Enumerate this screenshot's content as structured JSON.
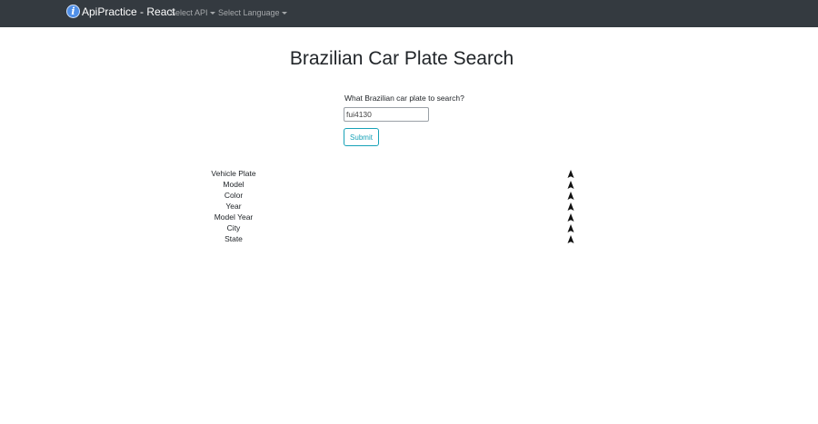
{
  "navbar": {
    "brand_logo_glyph": "i",
    "brand_label": "ApiPractice - React",
    "select_api_label": "Select API",
    "select_language_label": "Select Language"
  },
  "main": {
    "title": "Brazilian Car Plate Search",
    "question": "What Brazilian car plate to search?",
    "plate_input_value": "fui4130",
    "submit_label": "Submit"
  },
  "results": {
    "rows": [
      {
        "label": "Vehicle Plate",
        "icon": "sort-arrow-up-icon"
      },
      {
        "label": "Model",
        "icon": "sort-arrow-up-icon"
      },
      {
        "label": "Color",
        "icon": "sort-arrow-up-icon"
      },
      {
        "label": "Year",
        "icon": "sort-arrow-up-icon"
      },
      {
        "label": "Model Year",
        "icon": "sort-arrow-up-icon"
      },
      {
        "label": "City",
        "icon": "sort-arrow-up-icon"
      },
      {
        "label": "State",
        "icon": "sort-arrow-up-icon"
      }
    ]
  },
  "colors": {
    "navbar_bg": "#343a40",
    "accent_info": "#17a2b8",
    "brand_logo": "#4f8fe8"
  }
}
